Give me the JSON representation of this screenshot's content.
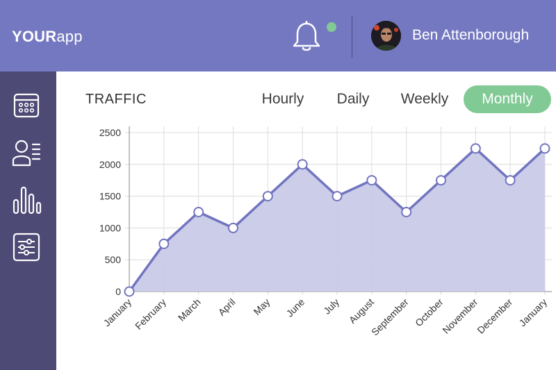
{
  "header": {
    "logo_bold": "YOUR",
    "logo_light": "app",
    "user_name": "Ben Attenborough",
    "notification_icon": "bell-icon",
    "notification_dot_color": "#81c995"
  },
  "sidebar": {
    "items": [
      {
        "icon": "calendar-icon"
      },
      {
        "icon": "users-icon"
      },
      {
        "icon": "bar-chart-icon"
      },
      {
        "icon": "settings-sliders-icon"
      }
    ]
  },
  "main": {
    "section_title": "TRAFFIC",
    "tabs": [
      {
        "label": "Hourly",
        "active": false
      },
      {
        "label": "Daily",
        "active": false
      },
      {
        "label": "Weekly",
        "active": false
      },
      {
        "label": "Monthly",
        "active": true
      }
    ]
  },
  "colors": {
    "header_bg": "#7478c0",
    "sidebar_bg": "#4e4a76",
    "accent_green": "#81c995",
    "line": "#7174bf",
    "area_fill": "#c9cae8"
  },
  "chart_data": {
    "type": "area",
    "categories": [
      "January",
      "February",
      "March",
      "April",
      "May",
      "June",
      "July",
      "August",
      "September",
      "October",
      "November",
      "December",
      "January"
    ],
    "values": [
      0,
      750,
      1250,
      1000,
      1500,
      2000,
      1500,
      1750,
      1250,
      1750,
      2250,
      1750,
      2250
    ],
    "yticks": [
      0,
      500,
      1000,
      1500,
      2000,
      2500
    ],
    "ylim": [
      0,
      2500
    ],
    "grid": true
  }
}
